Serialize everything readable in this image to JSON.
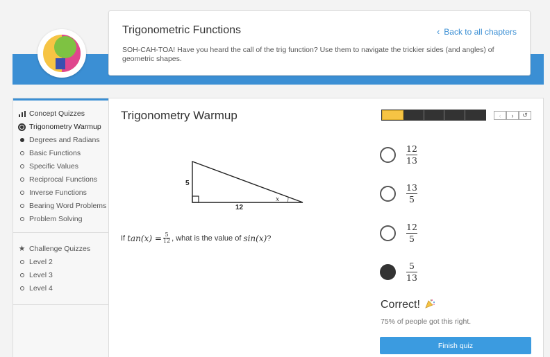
{
  "header": {
    "title": "Trigonometric Functions",
    "back_link": "Back to all chapters",
    "description": "SOH-CAH-TOA! Have you heard the call of the trig function? Use them to navigate the trickier sides (and angles) of geometric shapes."
  },
  "sidebar": {
    "concept_heading": "Concept Quizzes",
    "concept_items": [
      {
        "label": "Trigonometry Warmup",
        "state": "active"
      },
      {
        "label": "Degrees and Radians",
        "state": "filled"
      },
      {
        "label": "Basic Functions",
        "state": "empty"
      },
      {
        "label": "Specific Values",
        "state": "empty"
      },
      {
        "label": "Reciprocal Functions",
        "state": "empty"
      },
      {
        "label": "Inverse Functions",
        "state": "empty"
      },
      {
        "label": "Bearing Word Problems",
        "state": "empty"
      },
      {
        "label": "Problem Solving",
        "state": "empty"
      }
    ],
    "challenge_heading": "Challenge Quizzes",
    "challenge_items": [
      {
        "label": "Level 2"
      },
      {
        "label": "Level 3"
      },
      {
        "label": "Level 4"
      }
    ]
  },
  "quiz": {
    "title": "Trigonometry Warmup",
    "progress": {
      "completed": 1,
      "total": 5
    },
    "figure": {
      "side_vertical": "5",
      "side_horizontal": "12",
      "angle": "x"
    },
    "question": {
      "prefix": "If",
      "tan_expr": "tan(x) =",
      "num": "5",
      "den": "12",
      "middle": ", what is the value of",
      "sin_expr": "sin(x)",
      "suffix": "?"
    },
    "options": [
      {
        "num": "12",
        "den": "13",
        "selected": false
      },
      {
        "num": "13",
        "den": "5",
        "selected": false
      },
      {
        "num": "12",
        "den": "5",
        "selected": false
      },
      {
        "num": "5",
        "den": "13",
        "selected": true
      }
    ],
    "result": "Correct!",
    "stat": "75% of people got this right.",
    "finish_label": "Finish quiz"
  },
  "colors": {
    "accent": "#3b8fd4",
    "progress_fill": "#f6c444",
    "button": "#3b9be0"
  }
}
